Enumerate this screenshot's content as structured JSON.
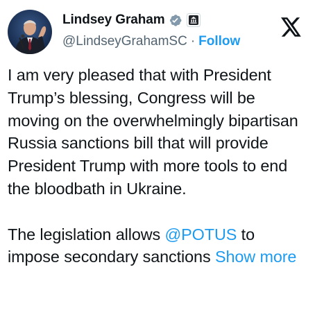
{
  "author": {
    "display_name": "Lindsey Graham",
    "handle": "@LindseyGrahamSC",
    "separator": "·",
    "follow_label": "Follow",
    "verified_icon": "verified-badge-icon",
    "affiliation_icon": "government-badge-icon",
    "avatar": "avatar-photo"
  },
  "platform": {
    "logo_icon": "x-logo-icon"
  },
  "tweet": {
    "paragraph_1": "I am very pleased that with President Trump’s blessing, Congress will be moving on the overwhelmingly bipartisan Russia sanctions bill that will provide President Trump with more tools to end the bloodbath in Ukraine.",
    "paragraph_2_lead": "The legislation allows ",
    "mention": "@POTUS",
    "paragraph_2_tail": " to impose secondary sanctions ",
    "show_more_label": "Show more"
  },
  "colors": {
    "accent": "#1d9bf0",
    "text": "#0f1419",
    "secondary": "#536471",
    "verified_gray": "#829aab"
  }
}
